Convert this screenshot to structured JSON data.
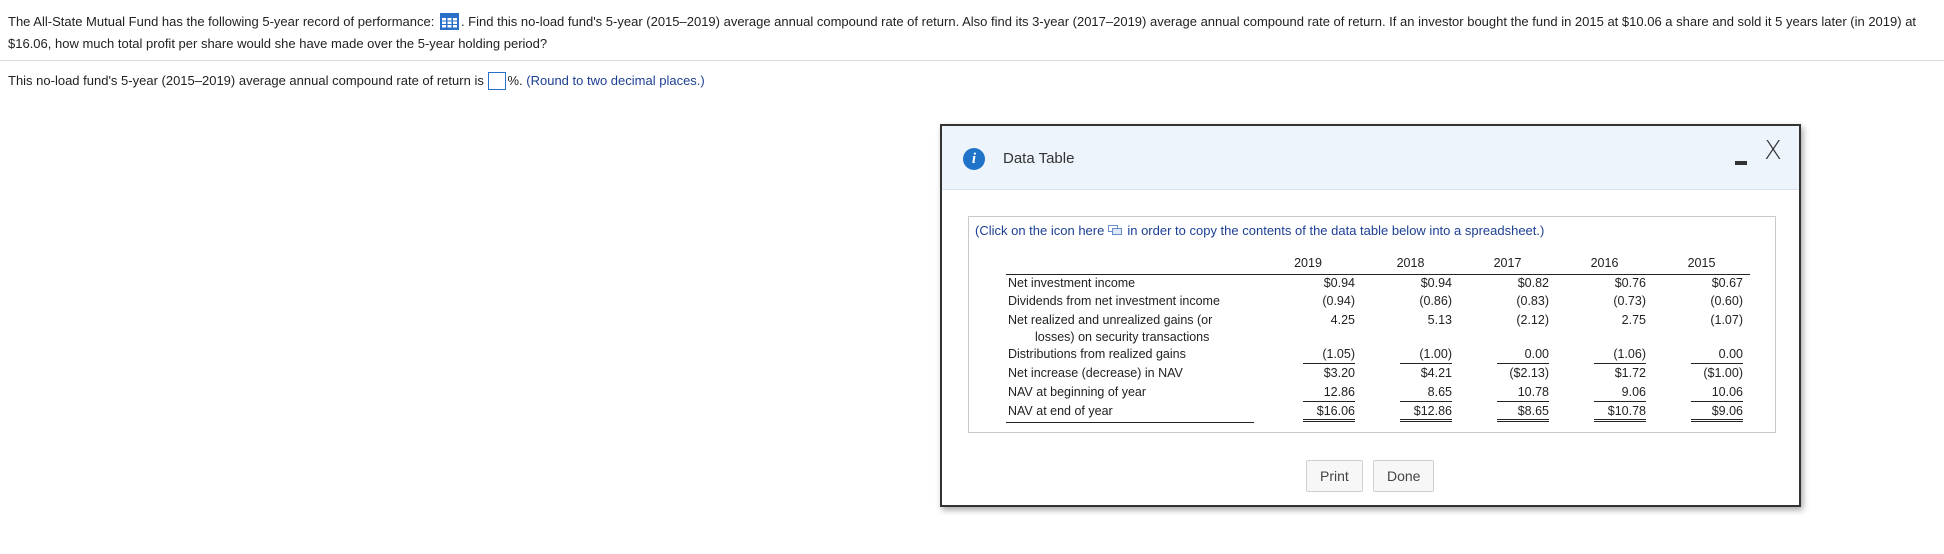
{
  "question": {
    "text_before_icon": "The All-State Mutual Fund has the following 5-year record of performance:",
    "text_after_icon": ". Find this no-load fund's 5-year (2015–2019) average annual compound rate of return. Also find its 3-year (2017–2019) average annual compound rate of return. If an investor bought the fund in 2015 at $10.06 a share and sold it 5 years later (in 2019) at $16.06, how much total profit per share would she have made over the 5-year holding period?",
    "icon": "data-table-icon"
  },
  "answer": {
    "prompt": "This no-load fund's 5-year (2015–2019) average annual compound rate of return is",
    "input_value": "",
    "suffix": "%.",
    "hint": "(Round to two decimal places.)"
  },
  "dialog": {
    "title": "Data Table",
    "info_icon": "i",
    "minimize_icon": "minimize-icon",
    "close_icon": "X",
    "copy_note_before": "(Click on the icon here",
    "copy_note_after": "in order to copy the contents of the data table below into a spreadsheet.)",
    "print_label": "Print",
    "done_label": "Done"
  },
  "table": {
    "years": [
      "2019",
      "2018",
      "2017",
      "2016",
      "2015"
    ],
    "rows": [
      {
        "label": "Net investment income",
        "label2": "",
        "values": [
          "$0.94",
          "$0.94",
          "$0.82",
          "$0.76",
          "$0.67"
        ],
        "style": "plain"
      },
      {
        "label": "Dividends from net investment income",
        "label2": "",
        "values": [
          "(0.94)",
          "(0.86)",
          "(0.83)",
          "(0.73)",
          "(0.60)"
        ],
        "style": "plain"
      },
      {
        "label": "Net realized and unrealized gains (or",
        "label2": "losses) on security transactions",
        "values": [
          "4.25",
          "5.13",
          "(2.12)",
          "2.75",
          "(1.07)"
        ],
        "style": "plain"
      },
      {
        "label": "Distributions from realized gains",
        "label2": "",
        "values": [
          "(1.05)",
          "(1.00)",
          "0.00",
          "(1.06)",
          "0.00"
        ],
        "style": "underline"
      },
      {
        "label": "Net increase (decrease) in NAV",
        "label2": "",
        "values": [
          "$3.20",
          "$4.21",
          "($2.13)",
          "$1.72",
          "($1.00)"
        ],
        "style": "plain"
      },
      {
        "label": "NAV at beginning of year",
        "label2": "",
        "values": [
          "12.86",
          "8.65",
          "10.78",
          "9.06",
          "10.06"
        ],
        "style": "underline"
      },
      {
        "label": "NAV at end of year",
        "label2": "",
        "values": [
          "$16.06",
          "$12.86",
          "$8.65",
          "$10.78",
          "$9.06"
        ],
        "style": "double"
      }
    ]
  }
}
